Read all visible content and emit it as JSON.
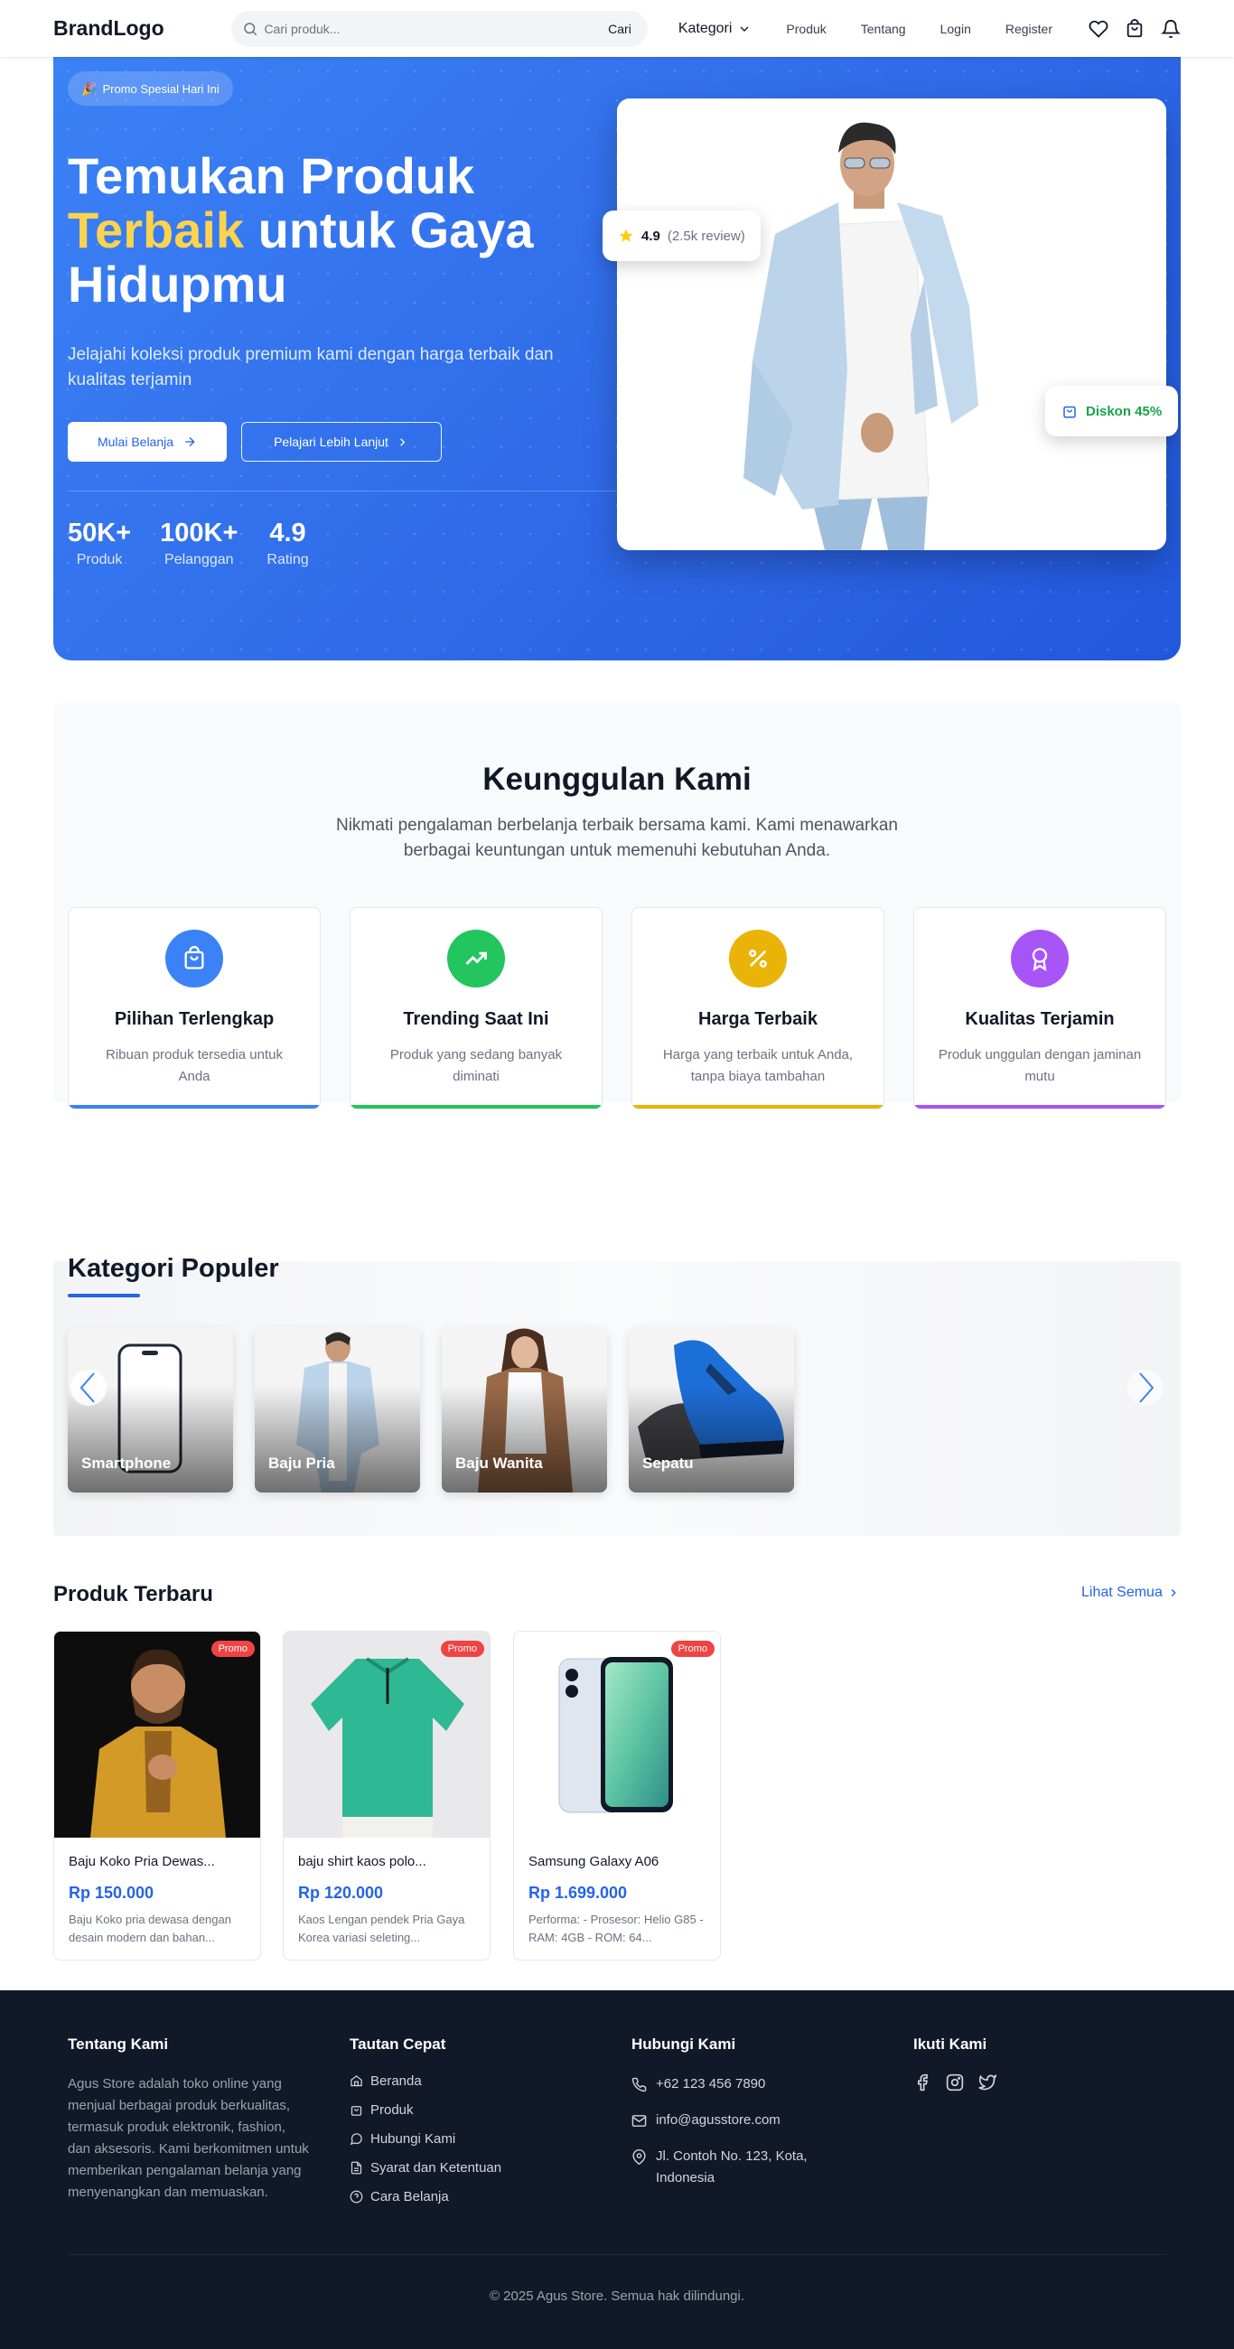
{
  "nav": {
    "brand": "BrandLogo",
    "search_placeholder": "Cari produk...",
    "search_button": "Cari",
    "kategori": "Kategori",
    "links": [
      "Produk",
      "Tentang",
      "Login",
      "Register"
    ],
    "icons": [
      "heart-icon",
      "cart-icon",
      "bell-icon"
    ]
  },
  "hero": {
    "badge": "Promo Spesial Hari Ini",
    "title_line1": "Temukan Produk",
    "title_highlight": "Terbaik",
    "title_rest": " untuk Gaya Hidupmu",
    "subtitle": "Jelajahi koleksi produk premium kami dengan harga terbaik dan kualitas terjamin",
    "btn_primary": "Mulai Belanja",
    "btn_secondary": "Pelajari Lebih Lanjut",
    "stats": [
      {
        "value": "50K+",
        "label": "Produk"
      },
      {
        "value": "100K+",
        "label": "Pelanggan"
      },
      {
        "value": "4.9",
        "label": "Rating"
      }
    ],
    "rating_value": "4.9",
    "rating_reviews": "(2.5k review)",
    "discount": "Diskon 45%",
    "colors": {
      "gradient_start": "#3b82f6",
      "gradient_end": "#2257dc",
      "highlight": "#fcd34d"
    }
  },
  "features": {
    "title": "Keunggulan Kami",
    "description": "Nikmati pengalaman berbelanja terbaik bersama kami. Kami menawarkan berbagai keuntungan untuk memenuhi kebutuhan Anda.",
    "items": [
      {
        "title": "Pilihan Terlengkap",
        "desc": "Ribuan produk tersedia untuk Anda",
        "color": "#3b82f6",
        "icon": "shopping-bag-icon"
      },
      {
        "title": "Trending Saat Ini",
        "desc": "Produk yang sedang banyak diminati",
        "color": "#22c55e",
        "icon": "trending-up-icon"
      },
      {
        "title": "Harga Terbaik",
        "desc": "Harga yang terbaik untuk Anda, tanpa biaya tambahan",
        "color": "#eab308",
        "icon": "percent-icon"
      },
      {
        "title": "Kualitas Terjamin",
        "desc": "Produk unggulan dengan jaminan mutu",
        "color": "#a855f7",
        "icon": "award-icon"
      }
    ]
  },
  "categories": {
    "title": "Kategori Populer",
    "items": [
      "Smartphone",
      "Baju Pria",
      "Baju Wanita",
      "Sepatu"
    ]
  },
  "products": {
    "title": "Produk Terbaru",
    "see_all": "Lihat Semua",
    "items": [
      {
        "tag": "Promo",
        "name": "Baju Koko Pria Dewas...",
        "price": "Rp 150.000",
        "desc": "Baju Koko pria dewasa dengan desain modern dan bahan..."
      },
      {
        "tag": "Promo",
        "name": "baju shirt kaos polo...",
        "price": "Rp 120.000",
        "desc": "Kaos Lengan pendek Pria Gaya Korea variasi seleting..."
      },
      {
        "tag": "Promo",
        "name": "Samsung Galaxy A06",
        "price": "Rp 1.699.000",
        "desc": "Performa: - Prosesor: Helio G85 - RAM: 4GB - ROM: 64..."
      }
    ]
  },
  "footer": {
    "about_title": "Tentang Kami",
    "about_text": "Agus Store adalah toko online yang menjual berbagai produk berkualitas, termasuk produk elektronik, fashion, dan aksesoris. Kami berkomitmen untuk memberikan pengalaman belanja yang menyenangkan dan memuaskan.",
    "links_title": "Tautan Cepat",
    "links": [
      "Beranda",
      "Produk",
      "Hubungi Kami",
      "Syarat dan Ketentuan",
      "Cara Belanja"
    ],
    "contact_title": "Hubungi Kami",
    "phone": "+62 123 456 7890",
    "email": "info@agusstore.com",
    "address": "Jl. Contoh No. 123, Kota, Indonesia",
    "social_title": "Ikuti Kami",
    "copyright": "© 2025 Agus Store. Semua hak dilindungi."
  }
}
